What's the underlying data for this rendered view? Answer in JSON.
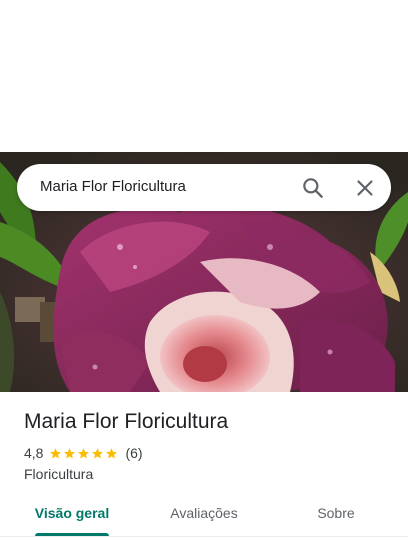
{
  "search": {
    "query": "Maria Flor Floricultura",
    "search_icon": "search-icon",
    "close_icon": "close-icon"
  },
  "place": {
    "name": "Maria Flor Floricultura",
    "rating": "4,8",
    "stars": 5,
    "review_count": "(6)",
    "category": "Floricultura"
  },
  "tabs": [
    {
      "label": "Visão geral",
      "active": true
    },
    {
      "label": "Avaliações",
      "active": false
    },
    {
      "label": "Sobre",
      "active": false
    }
  ],
  "colors": {
    "accent": "#00796b",
    "star": "#fbbc04",
    "text": "#202124",
    "secondary_text": "#3c4043"
  }
}
